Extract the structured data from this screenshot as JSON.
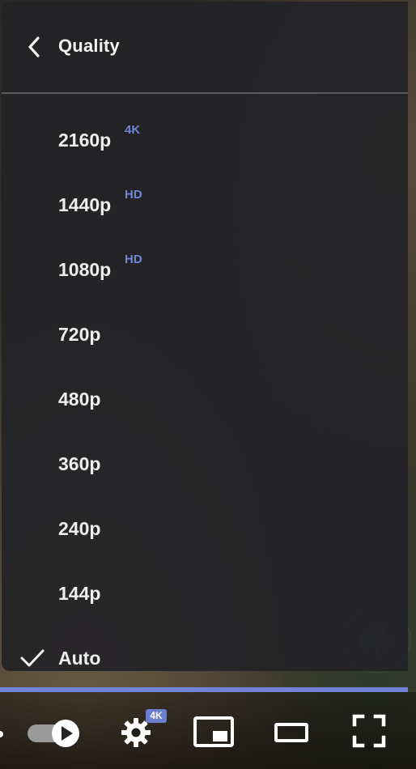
{
  "menu": {
    "title": "Quality",
    "options": [
      {
        "label": "2160p",
        "badge": "4K",
        "selected": false
      },
      {
        "label": "1440p",
        "badge": "HD",
        "selected": false
      },
      {
        "label": "1080p",
        "badge": "HD",
        "selected": false
      },
      {
        "label": "720p",
        "badge": "",
        "selected": false
      },
      {
        "label": "480p",
        "badge": "",
        "selected": false
      },
      {
        "label": "360p",
        "badge": "",
        "selected": false
      },
      {
        "label": "240p",
        "badge": "",
        "selected": false
      },
      {
        "label": "144p",
        "badge": "",
        "selected": false
      },
      {
        "label": "Auto",
        "badge": "",
        "selected": true
      }
    ]
  },
  "controls": {
    "autoplay_enabled": true,
    "quality_badge": "4K",
    "icons": [
      "autoplay-toggle-icon",
      "settings-gear-icon",
      "miniplayer-icon",
      "theater-mode-icon",
      "fullscreen-icon"
    ]
  },
  "colors": {
    "accent": "#6f86d6",
    "progress": "#7183d6",
    "menu_bg": "#232326",
    "text": "#eeeeee"
  }
}
